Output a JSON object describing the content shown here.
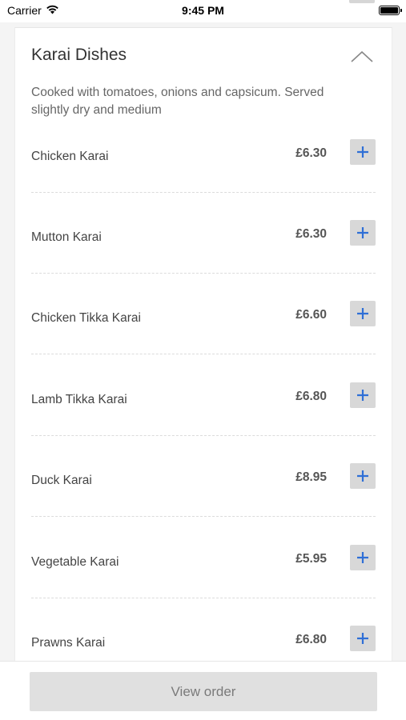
{
  "status_bar": {
    "carrier": "Carrier",
    "time": "9:45 PM"
  },
  "section": {
    "title": "Karai Dishes",
    "description": "Cooked with tomatoes, onions and capsicum. Served slightly dry and medium",
    "expanded": true
  },
  "items": [
    {
      "name": "Chicken Karai",
      "price": "£6.30"
    },
    {
      "name": "Mutton Karai",
      "price": "£6.30"
    },
    {
      "name": "Chicken Tikka Karai",
      "price": "£6.60"
    },
    {
      "name": "Lamb Tikka Karai",
      "price": "£6.80"
    },
    {
      "name": "Duck Karai",
      "price": "£8.95"
    },
    {
      "name": "Vegetable Karai",
      "price": "£5.95"
    },
    {
      "name": "Prawns Karai",
      "price": "£6.80"
    }
  ],
  "footer": {
    "view_order_label": "View order"
  },
  "colors": {
    "accent": "#2f6fd6",
    "button_bg": "#d8d8d8",
    "page_bg": "#f4f4f4"
  }
}
